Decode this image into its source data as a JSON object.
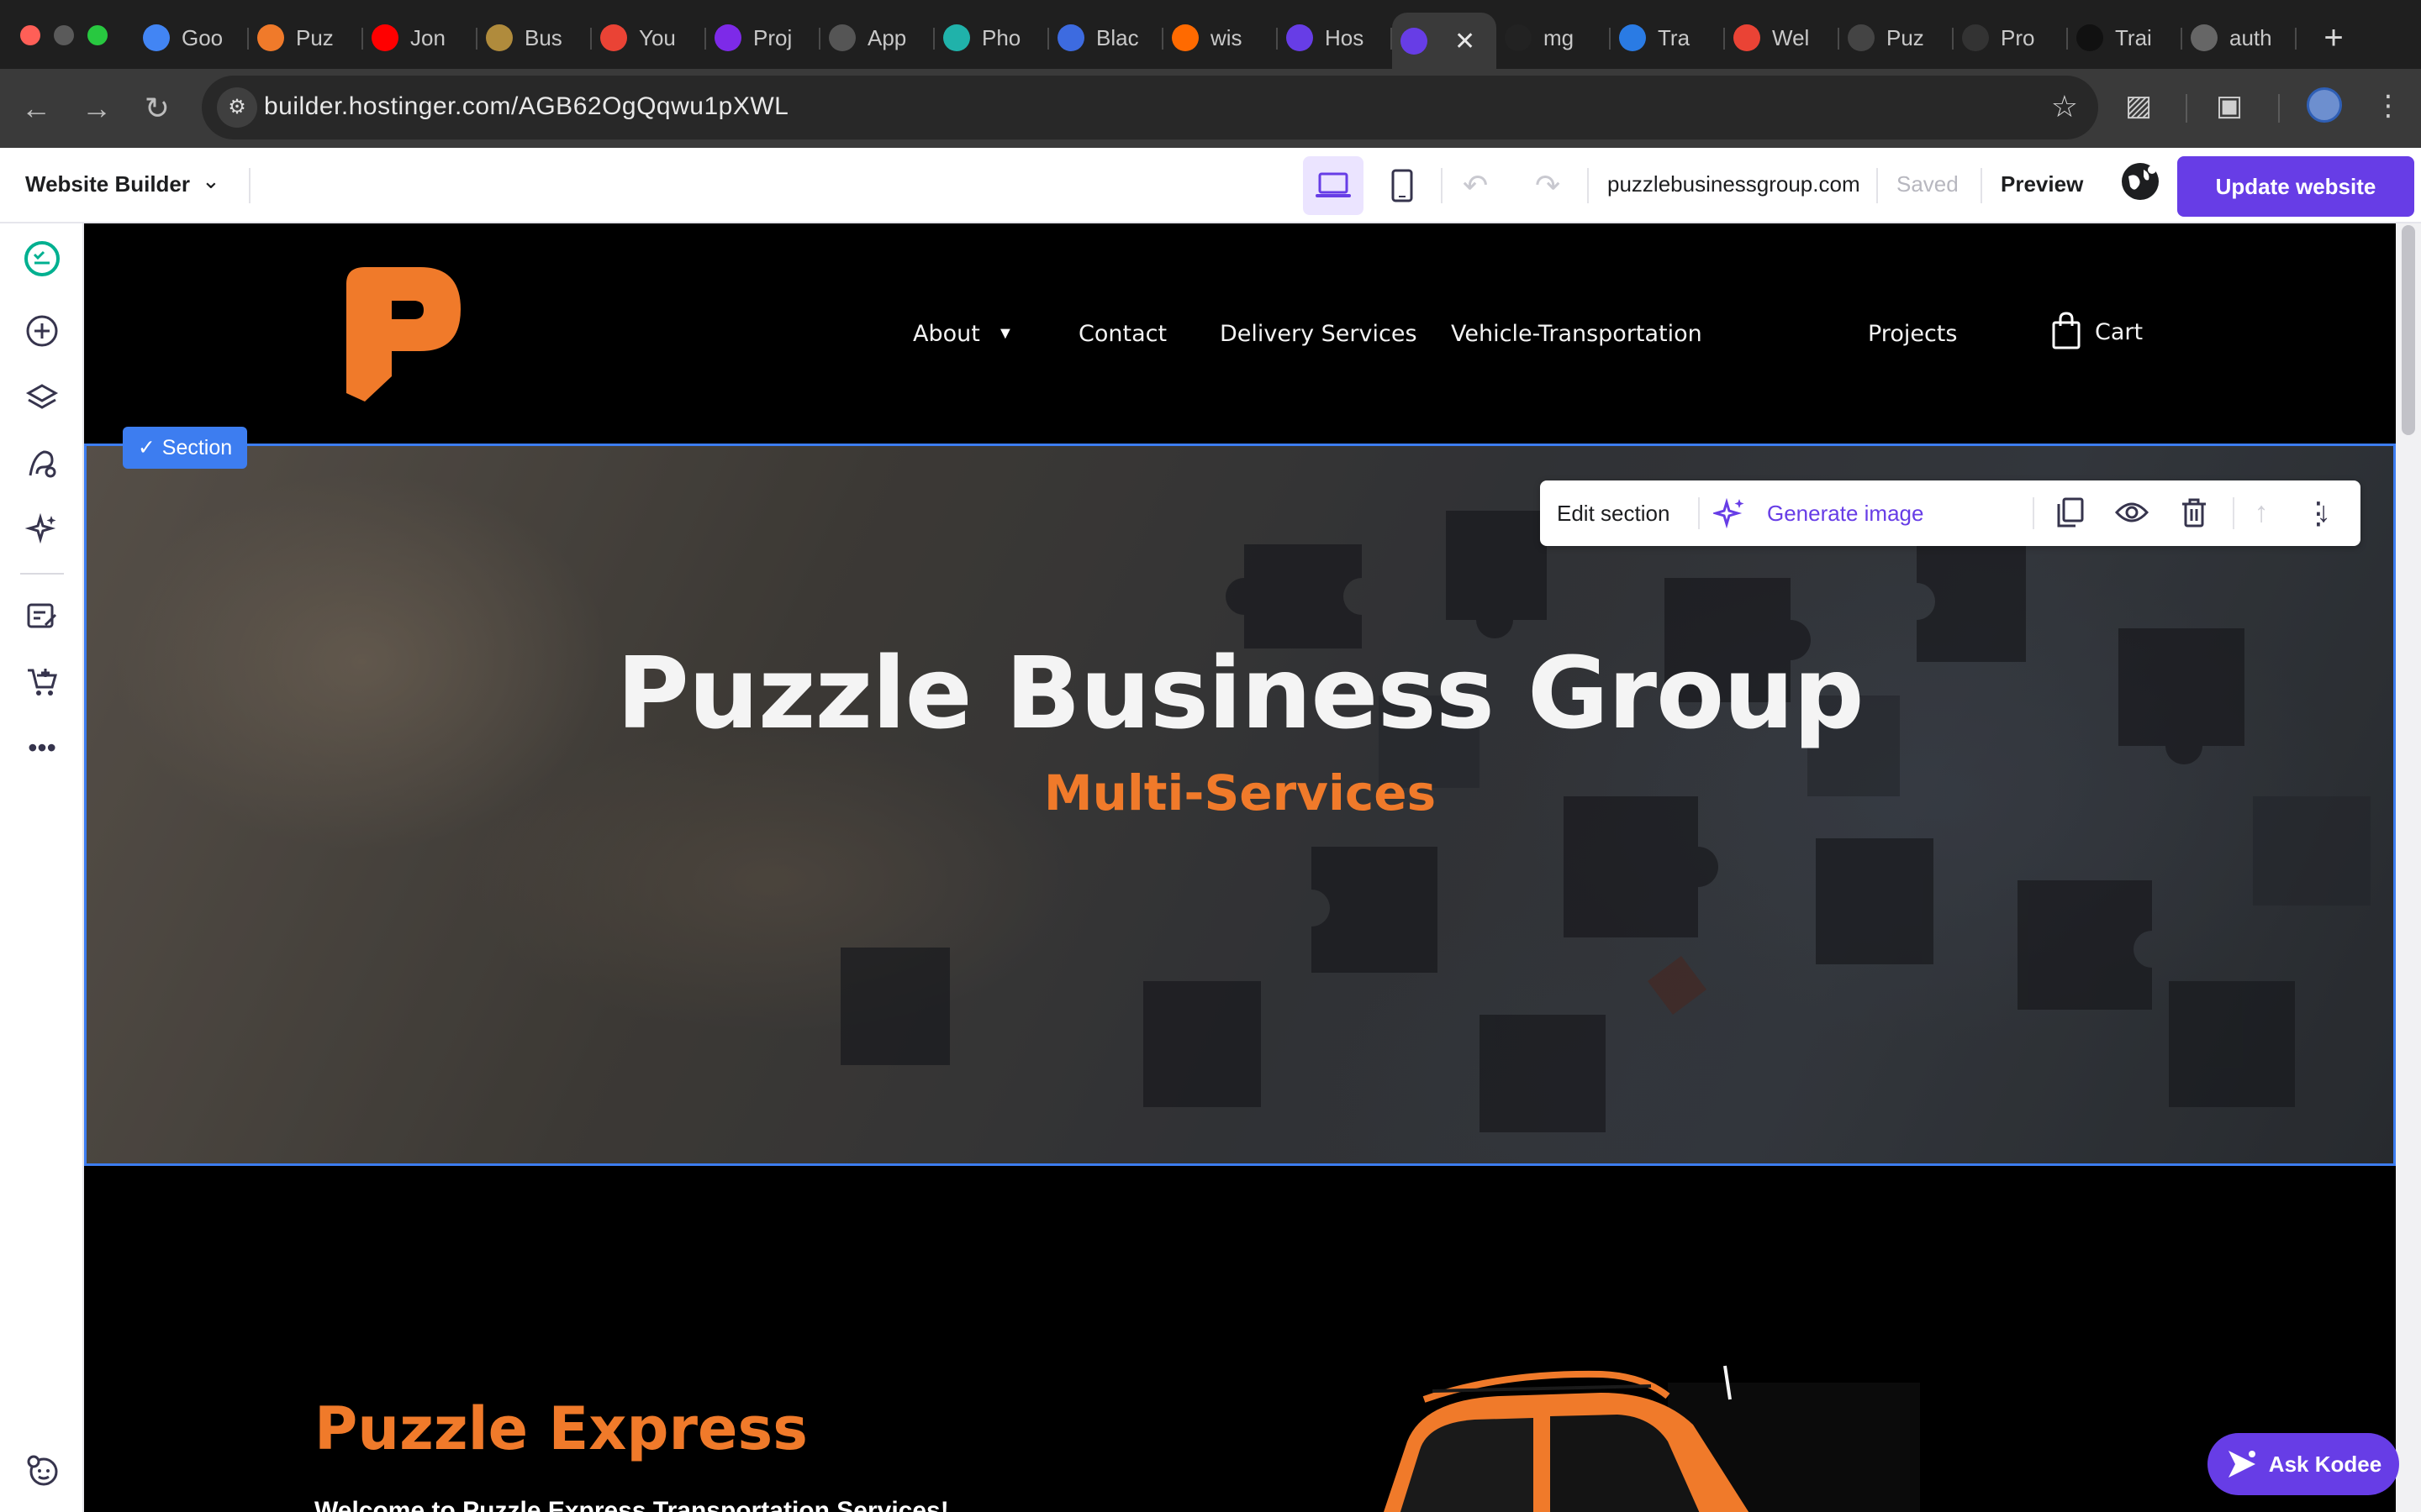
{
  "browser": {
    "tabs": [
      {
        "title": "Goo",
        "icon": "google-icon",
        "color": "#4285f4"
      },
      {
        "title": "Puz",
        "icon": "puzzle-icon",
        "color": "#f07a2a"
      },
      {
        "title": "Jon",
        "icon": "youtube-icon",
        "color": "#ff0000"
      },
      {
        "title": "Bus",
        "icon": "seal-icon",
        "color": "#b08b3c"
      },
      {
        "title": "You",
        "icon": "gmail-icon",
        "color": "#ea4335"
      },
      {
        "title": "Proj",
        "icon": "canva-icon",
        "color": "#7d2ae8"
      },
      {
        "title": "App",
        "icon": "apple-icon",
        "color": "#555555"
      },
      {
        "title": "Pho",
        "icon": "photoroom-icon",
        "color": "#20b2aa"
      },
      {
        "title": "Blac",
        "icon": "canva-icon",
        "color": "#3d6be0"
      },
      {
        "title": "wis",
        "icon": "fire-icon",
        "color": "#ff6a00"
      },
      {
        "title": "Hos",
        "icon": "hostinger-icon",
        "color": "#673de6"
      },
      {
        "title": "",
        "icon": "hostinger-icon",
        "color": "#673de6",
        "active": true
      },
      {
        "title": "mg",
        "icon": "github-icon",
        "color": "#222222"
      },
      {
        "title": "Tra",
        "icon": "flag-icon",
        "color": "#2a7be4"
      },
      {
        "title": "Wel",
        "icon": "gmail-icon",
        "color": "#ea4335"
      },
      {
        "title": "Puz",
        "icon": "openai-icon",
        "color": "#444444"
      },
      {
        "title": "Pro",
        "icon": "scissors-icon",
        "color": "#333333"
      },
      {
        "title": "Trai",
        "icon": "dot-icon",
        "color": "#111111"
      },
      {
        "title": "auth",
        "icon": "globe-icon",
        "color": "#666666"
      }
    ],
    "url": "builder.hostinger.com/AGB62OgQqwu1pXWL"
  },
  "builder": {
    "title": "Website Builder",
    "domain": "puzzlebusinessgroup.com",
    "saved_label": "Saved",
    "preview_label": "Preview",
    "update_label": "Update website",
    "accent": "#673de6"
  },
  "site": {
    "nav": {
      "about": "About",
      "contact": "Contact",
      "delivery": "Delivery Services",
      "vehicle": "Vehicle-Transportation",
      "projects": "Projects",
      "cart": "Cart"
    },
    "section_badge": "Section",
    "toolbar": {
      "edit": "Edit section",
      "generate": "Generate image"
    },
    "hero": {
      "title": "Puzzle Business Group",
      "subtitle": "Multi-Services"
    },
    "express": {
      "title": "Puzzle Express",
      "text": "Welcome to Puzzle Express Transportation Services!"
    },
    "brand_orange": "#f07a2a"
  },
  "assistant": {
    "label": "Ask Kodee"
  }
}
